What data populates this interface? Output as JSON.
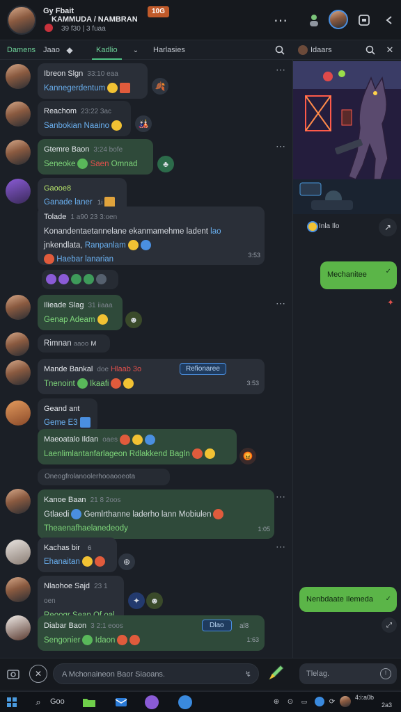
{
  "header": {
    "line1": "Gy Fbait",
    "line2": "KAMMUDA / NAMBRAN",
    "line3": "39 f30 | 3 fuaa",
    "badge": "10G"
  },
  "tabs": {
    "t1": "Damens",
    "t2": "Jaao",
    "t3": "Kadlio",
    "t4": "Harlasies",
    "t5": "Idaars"
  },
  "messages": [
    {
      "name": "Ibreon Slgn",
      "time": "33:10 eaa",
      "text": "Kannegerdentum"
    },
    {
      "name": "Reachom",
      "time": "23:22 3ac",
      "text": "Sanbokian Naaino"
    },
    {
      "name": "Gtemre Baon",
      "time": "3:24 bofe",
      "text1": "Seneoke",
      "text2": "Saen",
      "text3": "Omnad"
    },
    {
      "name": "Gaooe8",
      "time": "",
      "text": "Ganade laner",
      "tag": "1i"
    },
    {
      "name": "Tolade",
      "time": "1 a90  23 3:oen",
      "text1": "Konandentaetannelane ekanmamehme ladent",
      "tail": "lao",
      "text2": "jnkendlata,",
      "link": "Ranpanlam",
      "text3": "Haebar lanarian",
      "time2": "3:53"
    },
    {
      "name": "Ilieade Slag",
      "time": "31 iiaaa",
      "text": "Genap Adeam"
    },
    {
      "name": "Rimnan",
      "time": "aaoo",
      "tag": "M"
    },
    {
      "name": "Mande Bankal",
      "time": "doe",
      "red": "Hlaab 3o",
      "text": "Tnenoint",
      "tag2": "Ikaafi",
      "pill": "Refionaree",
      "time2": "3:53"
    },
    {
      "name": "Geand ant",
      "time": "",
      "text": "Geme E3"
    },
    {
      "name": "Maeoatalo Ildan",
      "time": "oaes",
      "text": "Laenlimlantanfarlageon",
      "tail": "Rdlakkend Bagln"
    },
    {
      "name": "",
      "time": "",
      "text": "Oneogfrolanoolerhooaooeota"
    },
    {
      "name": "Kanoe Baan",
      "time": "21 8 2oos",
      "text1": "Gtlaedi",
      "text2": "Gemlrthanne laderho lann Mobiulen",
      "text3": "Theaenafhaelanedeody",
      "time2": "1:05"
    },
    {
      "name": "Kachas bir",
      "time": "6",
      "text": "Ehanaitan"
    },
    {
      "name": "Nlaohoe Sajd",
      "time": "23 1 oen",
      "text": "Reoogr Sean",
      "tail": "Of oal"
    },
    {
      "name": "Diabar Baon",
      "time": "3 2:1 eoos",
      "text": "Sengonier",
      "tag": "Idaon",
      "pill": "Dlao",
      "extra": "al8",
      "time2": "1:63"
    }
  ],
  "side": {
    "caption": "Inla Ilo",
    "bubble1": "Mechanitee",
    "bubble2": "Nenbdaate Ilemeda"
  },
  "composer": {
    "placeholder": "A Mchonaineon Baor Siaoans.",
    "side_placeholder": "Tlelag."
  },
  "taskbar": {
    "item": "Goo",
    "tray1": "4:i:a0b",
    "tray2": "2a3"
  },
  "colors": {
    "accent": "#4fc384",
    "bubble_out": "#5bb548",
    "link": "#6ab0f0"
  }
}
